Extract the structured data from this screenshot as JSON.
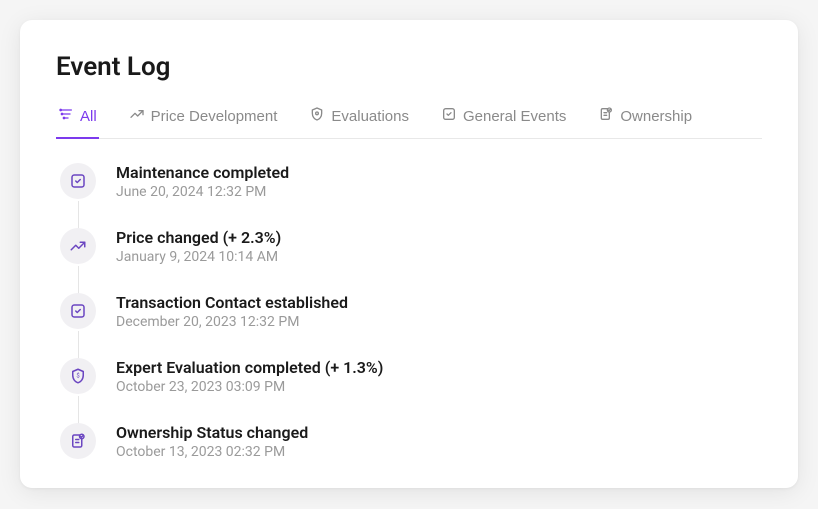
{
  "header": {
    "title": "Event Log"
  },
  "tabs": [
    {
      "id": "all",
      "label": "All",
      "icon": "filter",
      "active": true
    },
    {
      "id": "price",
      "label": "Price Development",
      "icon": "trend",
      "active": false
    },
    {
      "id": "evaluations",
      "label": "Evaluations",
      "icon": "shield",
      "active": false
    },
    {
      "id": "general",
      "label": "General Events",
      "icon": "check-square",
      "active": false
    },
    {
      "id": "ownership",
      "label": "Ownership",
      "icon": "doc-check",
      "active": false
    }
  ],
  "events": [
    {
      "icon": "check-square",
      "title": "Maintenance completed",
      "date": "June 20, 2024 12:32 PM"
    },
    {
      "icon": "trend",
      "title": "Price changed (+ 2.3%)",
      "date": "January 9, 2024 10:14 AM"
    },
    {
      "icon": "check-square",
      "title": "Transaction Contact established",
      "date": "December 20, 2023 12:32 PM"
    },
    {
      "icon": "shield",
      "title": "Expert Evaluation completed (+ 1.3%)",
      "date": "October 23, 2023 03:09 PM"
    },
    {
      "icon": "doc-check",
      "title": "Ownership Status changed",
      "date": "October 13, 2023 02:32 PM"
    }
  ],
  "colors": {
    "accent": "#7c3aed",
    "iconBg": "#f1f0f3",
    "iconColor": "#6b46c1",
    "textMuted": "#9a9a9a"
  }
}
